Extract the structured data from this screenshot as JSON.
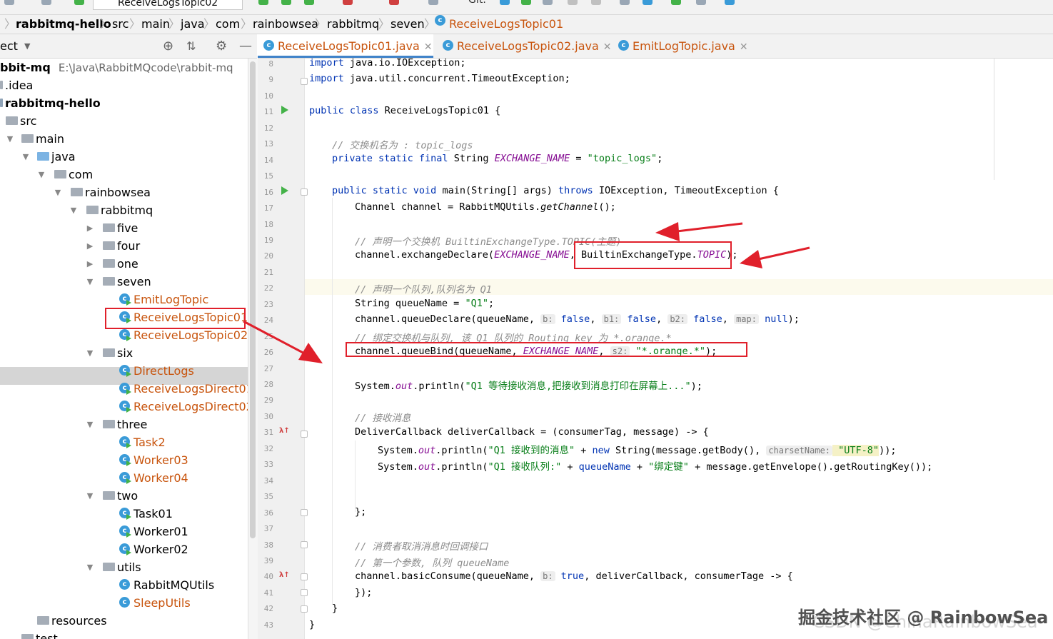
{
  "top_bar": {
    "run_config": "ReceiveLogsTopic02",
    "git_label": "Git:"
  },
  "breadcrumb": [
    "rabbitmq-hello",
    "src",
    "main",
    "java",
    "com",
    "rainbowsea",
    "rabbitmq",
    "seven",
    "ReceiveLogsTopic01"
  ],
  "project_panel": {
    "title": "ect"
  },
  "tree": {
    "project_root": "bbit-mq",
    "project_path": "E:\\Java\\RabbitMQcode\\rabbit-mq",
    "items": [
      ".idea",
      "rabbitmq-hello",
      "src",
      "main",
      "java",
      "com",
      "rainbowsea",
      "rabbitmq",
      "five",
      "four",
      "one",
      "seven",
      "EmitLogTopic",
      "ReceiveLogsTopic01",
      "ReceiveLogsTopic02",
      "six",
      "DirectLogs",
      "ReceiveLogsDirect01",
      "ReceiveLogsDirect02",
      "three",
      "Task2",
      "Worker03",
      "Worker04",
      "two",
      "Task01",
      "Worker01",
      "Worker02",
      "utils",
      "RabbitMQUtils",
      "SleepUtils",
      "resources",
      "test"
    ]
  },
  "tabs": [
    "ReceiveLogsTopic01.java",
    "ReceiveLogsTopic02.java",
    "EmitLogTopic.java"
  ],
  "line_numbers": [
    "8",
    "9",
    "10",
    "11",
    "12",
    "13",
    "14",
    "15",
    "16",
    "17",
    "18",
    "19",
    "20",
    "21",
    "22",
    "23",
    "24",
    "25",
    "26",
    "27",
    "28",
    "29",
    "30",
    "31",
    "32",
    "33",
    "34",
    "35",
    "36",
    "37",
    "38",
    "39",
    "40",
    "41",
    "42",
    "43"
  ],
  "code": {
    "l8_a": "import",
    "l8_b": " java.io.IOException;",
    "l9_a": "import",
    "l9_b": " java.util.concurrent.TimeoutException;",
    "l11_a": "public class",
    "l11_b": " ReceiveLogsTopic01 {",
    "l13": "// 交换机名为 : topic_logs",
    "l14_a": "private static final",
    "l14_b": " String ",
    "l14_c": "EXCHANGE_NAME",
    "l14_d": " = ",
    "l14_e": "\"topic_logs\"",
    "l14_f": ";",
    "l16_a": "public static void",
    "l16_b": " main(String[] args) ",
    "l16_c": "throws",
    "l16_d": " IOException, TimeoutException {",
    "l17_a": "Channel channel = RabbitMQUtils.",
    "l17_b": "getChannel",
    "l17_c": "();",
    "l19": "// 声明一个交换机 BuiltinExchangeType.TOPIC(主题)",
    "l20_a": "channel.exchangeDeclare(",
    "l20_b": "EXCHANGE_NAME",
    "l20_c": ", BuiltinExchangeType.",
    "l20_d": "TOPIC",
    "l20_e": ");",
    "l22": "// 声明一个队列,队列名为 Q1",
    "l23_a": "String queueName = ",
    "l23_b": "\"Q1\"",
    "l23_c": ";",
    "l24_a": "channel.queueDeclare(queueName, ",
    "l24_h1": "b:",
    "l24_v1": " false",
    "l24_b": ", ",
    "l24_h2": "b1:",
    "l24_v2": " false",
    "l24_c": ", ",
    "l24_h3": "b2:",
    "l24_v3": " false",
    "l24_d": ", ",
    "l24_h4": "map:",
    "l24_v4": " null",
    "l24_e": ");",
    "l25": "// 绑定交换机与队列, 该 Q1 队列的 Routing key 为 *.orange.*",
    "l26_a": "channel.queueBind(queueName, ",
    "l26_b": "EXCHANGE_NAME",
    "l26_c": ", ",
    "l26_h": "s2:",
    "l26_d": " \"*.orange.*\"",
    "l26_e": ");",
    "l28_a": "System.",
    "l28_b": "out",
    "l28_c": ".println(",
    "l28_d": "\"Q1 等待接收消息,把接收到消息打印在屏幕上...\"",
    "l28_e": ");",
    "l30": "// 接收消息",
    "l31_a": "DeliverCallback deliverCallback = (consumerTag, message) -> {",
    "l32_a": "System.",
    "l32_b": "out",
    "l32_c": ".println(",
    "l32_d": "\"Q1 接收到的消息\"",
    "l32_e": " + ",
    "l32_f": "new",
    "l32_g": " String(message.getBody(), ",
    "l32_h": "charsetName:",
    "l32_i": " \"UTF-8\"",
    "l32_j": "));",
    "l33_a": "System.",
    "l33_b": "out",
    "l33_c": ".println(",
    "l33_d": "\"Q1 接收队列:\"",
    "l33_e": " + ",
    "l33_f": "queueName",
    "l33_g": " + ",
    "l33_h": "\"绑定键\"",
    "l33_i": " + message.getEnvelope().getRoutingKey());",
    "l36": "};",
    "l38": "// 消费者取消消息时回调接口",
    "l39": "// 第一个参数, 队列 queueName",
    "l40_a": "channel.basicConsume(queueName, ",
    "l40_h": "b:",
    "l40_b": " true",
    "l40_c": ", deliverCallback, consumerTage -> {",
    "l41": "});",
    "l42": "}",
    "l43": "}"
  },
  "watermark": {
    "line1": "掘金技术社区 @ RainbowSea",
    "line2": "CSDN @ChinaRainbowSea"
  },
  "colors": {
    "annotation_red": "#e0202b",
    "keyword": "#0033b3",
    "string": "#067d17",
    "constant": "#871094",
    "class_orange": "#c8540d"
  }
}
